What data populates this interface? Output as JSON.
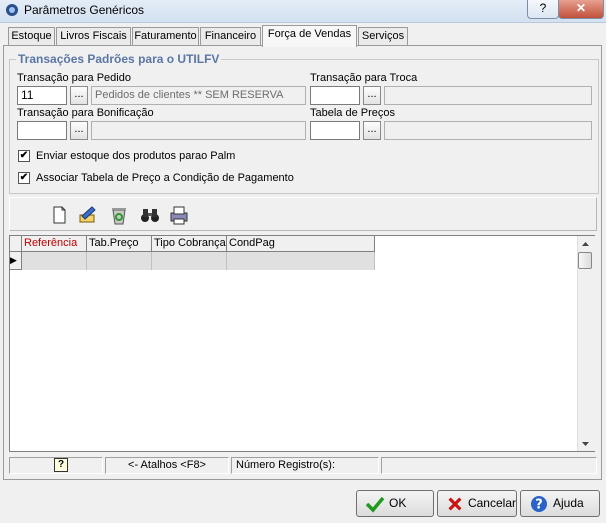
{
  "window": {
    "title": "Parâmetros Genéricos",
    "help_btn": "?",
    "close_btn": "✕"
  },
  "tabs": [
    {
      "label": "Estoque"
    },
    {
      "label": "Livros Fiscais"
    },
    {
      "label": "Faturamento"
    },
    {
      "label": "Financeiro"
    },
    {
      "label": "Força de Vendas"
    },
    {
      "label": "Serviços"
    }
  ],
  "active_tab": "Força de Vendas",
  "group": {
    "title": "Transações Padrões para o UTILFV",
    "pedido": {
      "label": "Transação para Pedido",
      "code": "11",
      "description": "Pedidos de clientes ** SEM RESERVA"
    },
    "troca": {
      "label": "Transação para Troca",
      "code": "",
      "description": ""
    },
    "bonificacao": {
      "label": "Transação para Bonificação",
      "code": "",
      "description": ""
    },
    "tabela_precos": {
      "label": "Tabela de Preços",
      "code": "",
      "description": ""
    },
    "ellipsis": "..."
  },
  "checks": [
    {
      "label": "Enviar estoque dos produtos parao Palm",
      "checked": true,
      "mark": "✔"
    },
    {
      "label": "Associar Tabela de Preço a Condição de Pagamento",
      "checked": true,
      "mark": "✔"
    }
  ],
  "grid": {
    "columns": [
      "Referência",
      "Tab.Preço",
      "Tipo Cobrança",
      "CondPag"
    ],
    "row_indicator": "▶"
  },
  "status": {
    "help_icon": "?",
    "atalhos": "<- Atalhos <F8>",
    "registro": "Número Registro(s):"
  },
  "buttons": {
    "ok": "OK",
    "cancel": "Cancelar",
    "help": "Ajuda"
  }
}
